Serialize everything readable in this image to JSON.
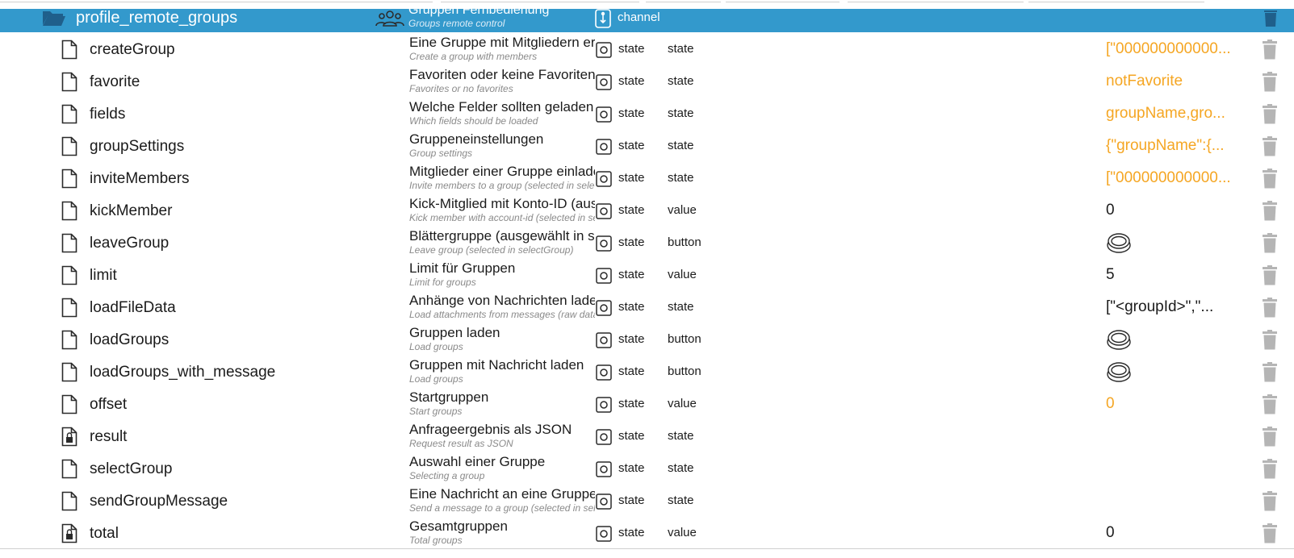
{
  "header": {
    "name": "profile_remote_groups",
    "desc_de": "Gruppen Fernbedienung",
    "desc_en": "Groups remote control",
    "type": "channel"
  },
  "rows": [
    {
      "name": "createGroup",
      "de": "Eine Gruppe mit Mitgliedern erstellen",
      "en": "Create a group with members",
      "role": "state",
      "common": "state",
      "value": "[\"000000000000...",
      "value_kind": "text",
      "value_color": "orange",
      "locked": false
    },
    {
      "name": "favorite",
      "de": "Favoriten oder keine Favoriten",
      "en": "Favorites or no favorites",
      "role": "state",
      "common": "state",
      "value": "notFavorite",
      "value_kind": "text",
      "value_color": "orange",
      "locked": false
    },
    {
      "name": "fields",
      "de": "Welche Felder sollten geladen werden",
      "en": "Which fields should be loaded",
      "role": "state",
      "common": "state",
      "value": "groupName,gro...",
      "value_kind": "text",
      "value_color": "orange",
      "locked": false
    },
    {
      "name": "groupSettings",
      "de": "Gruppeneinstellungen",
      "en": "Group settings",
      "role": "state",
      "common": "state",
      "value": "{\"groupName\":{...",
      "value_kind": "text",
      "value_color": "orange",
      "locked": false
    },
    {
      "name": "inviteMembers",
      "de": "Mitglieder einer Gruppe einladen",
      "en": "Invite members to a group (selected in selectGroup)",
      "role": "state",
      "common": "state",
      "value": "[\"000000000000...",
      "value_kind": "text",
      "value_color": "orange",
      "locked": false
    },
    {
      "name": "kickMember",
      "de": "Kick-Mitglied mit Konto-ID (ausgewählt in selectGroup)",
      "en": "Kick member with account-id (selected in selectGroup)",
      "role": "state",
      "common": "value",
      "value": "0",
      "value_kind": "text",
      "value_color": "black",
      "locked": false
    },
    {
      "name": "leaveGroup",
      "de": "Blättergruppe (ausgewählt in selectGroup)",
      "en": "Leave group (selected in selectGroup)",
      "role": "state",
      "common": "button",
      "value": "",
      "value_kind": "button",
      "value_color": "black",
      "locked": false
    },
    {
      "name": "limit",
      "de": "Limit für Gruppen",
      "en": "Limit for groups",
      "role": "state",
      "common": "value",
      "value": "5",
      "value_kind": "text",
      "value_color": "black",
      "locked": false
    },
    {
      "name": "loadFileData",
      "de": "Anhänge von Nachrichten laden",
      "en": "Load attachments from messages (raw data)",
      "role": "state",
      "common": "state",
      "value": "[\"<groupId>\",\"...",
      "value_kind": "text",
      "value_color": "black",
      "locked": false
    },
    {
      "name": "loadGroups",
      "de": "Gruppen laden",
      "en": "Load groups",
      "role": "state",
      "common": "button",
      "value": "",
      "value_kind": "button",
      "value_color": "black",
      "locked": false
    },
    {
      "name": "loadGroups_with_message",
      "de": "Gruppen mit Nachricht laden",
      "en": "Load groups",
      "role": "state",
      "common": "button",
      "value": "",
      "value_kind": "button",
      "value_color": "black",
      "locked": false
    },
    {
      "name": "offset",
      "de": "Startgruppen",
      "en": "Start groups",
      "role": "state",
      "common": "value",
      "value": "0",
      "value_kind": "text",
      "value_color": "orange",
      "locked": false
    },
    {
      "name": "result",
      "de": "Anfrageergebnis als JSON",
      "en": "Request result as JSON",
      "role": "state",
      "common": "state",
      "value": "",
      "value_kind": "text",
      "value_color": "black",
      "locked": true
    },
    {
      "name": "selectGroup",
      "de": "Auswahl einer Gruppe",
      "en": "Selecting a group",
      "role": "state",
      "common": "state",
      "value": "",
      "value_kind": "text",
      "value_color": "black",
      "locked": false
    },
    {
      "name": "sendGroupMessage",
      "de": "Eine Nachricht an eine Gruppe senden",
      "en": "Send a message to a group (selected in selectGroup)",
      "role": "state",
      "common": "state",
      "value": "",
      "value_kind": "text",
      "value_color": "black",
      "locked": false
    },
    {
      "name": "total",
      "de": "Gesamtgruppen",
      "en": "Total groups",
      "role": "state",
      "common": "value",
      "value": "0",
      "value_kind": "text",
      "value_color": "black",
      "locked": true
    }
  ],
  "colors": {
    "header_bg": "#3399cc",
    "value_orange": "#f5a623",
    "icon_grey": "#b5b5b5"
  }
}
